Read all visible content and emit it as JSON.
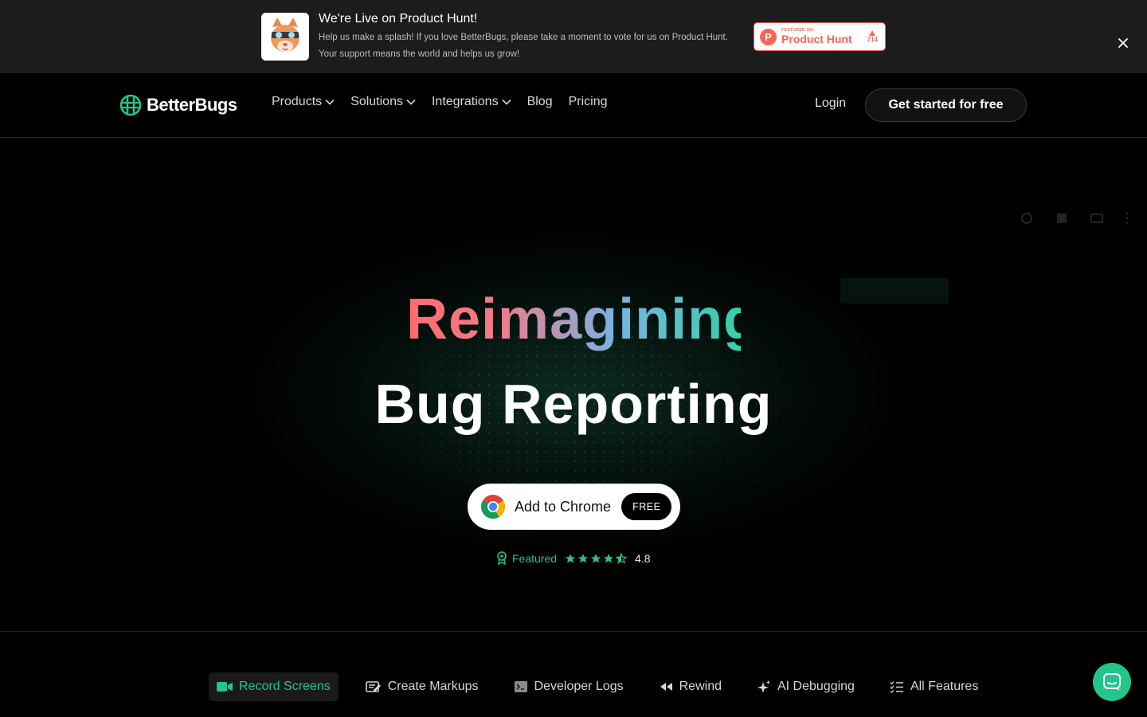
{
  "promo": {
    "title": "We're Live on Product Hunt!",
    "description": "Help us make a splash! If you love BetterBugs, please take a moment to vote for us on Product Hunt. Your support means the world and helps us grow!",
    "badge": {
      "small_label": "FEATURED ON",
      "name": "Product Hunt",
      "logo_letter": "P",
      "votes": "714"
    },
    "close_icon": "close-icon"
  },
  "nav": {
    "brand": "BetterBugs",
    "links": [
      {
        "label": "Products",
        "has_dropdown": true
      },
      {
        "label": "Solutions",
        "has_dropdown": true
      },
      {
        "label": "Integrations",
        "has_dropdown": true
      },
      {
        "label": "Blog",
        "has_dropdown": false
      },
      {
        "label": "Pricing",
        "has_dropdown": false
      }
    ],
    "login": "Login",
    "cta": "Get started for free"
  },
  "hero": {
    "headline_gradient": "Reimagining",
    "headline": "Bug Reporting",
    "chrome_button": {
      "label": "Add to Chrome",
      "badge": "FREE",
      "icon": "chrome-icon"
    },
    "rating": {
      "featured_label": "Featured",
      "stars": 4.5,
      "score": "4.8"
    }
  },
  "tabs": [
    {
      "label": "Record Screens",
      "icon": "video-camera-icon",
      "active": true
    },
    {
      "label": "Create Markups",
      "icon": "pencil-markup-icon",
      "active": false
    },
    {
      "label": "Developer Logs",
      "icon": "terminal-icon",
      "active": false
    },
    {
      "label": "Rewind",
      "icon": "rewind-icon",
      "active": false
    },
    {
      "label": "AI Debugging",
      "icon": "sparkles-icon",
      "active": false
    },
    {
      "label": "All Features",
      "icon": "checklist-icon",
      "active": false
    }
  ],
  "colors": {
    "accent": "#22c58a",
    "product_hunt": "#ff6154",
    "banner_bg": "#1c1c1c",
    "page_bg": "#000000"
  },
  "chat": {
    "icon": "chat-bubble-icon"
  }
}
